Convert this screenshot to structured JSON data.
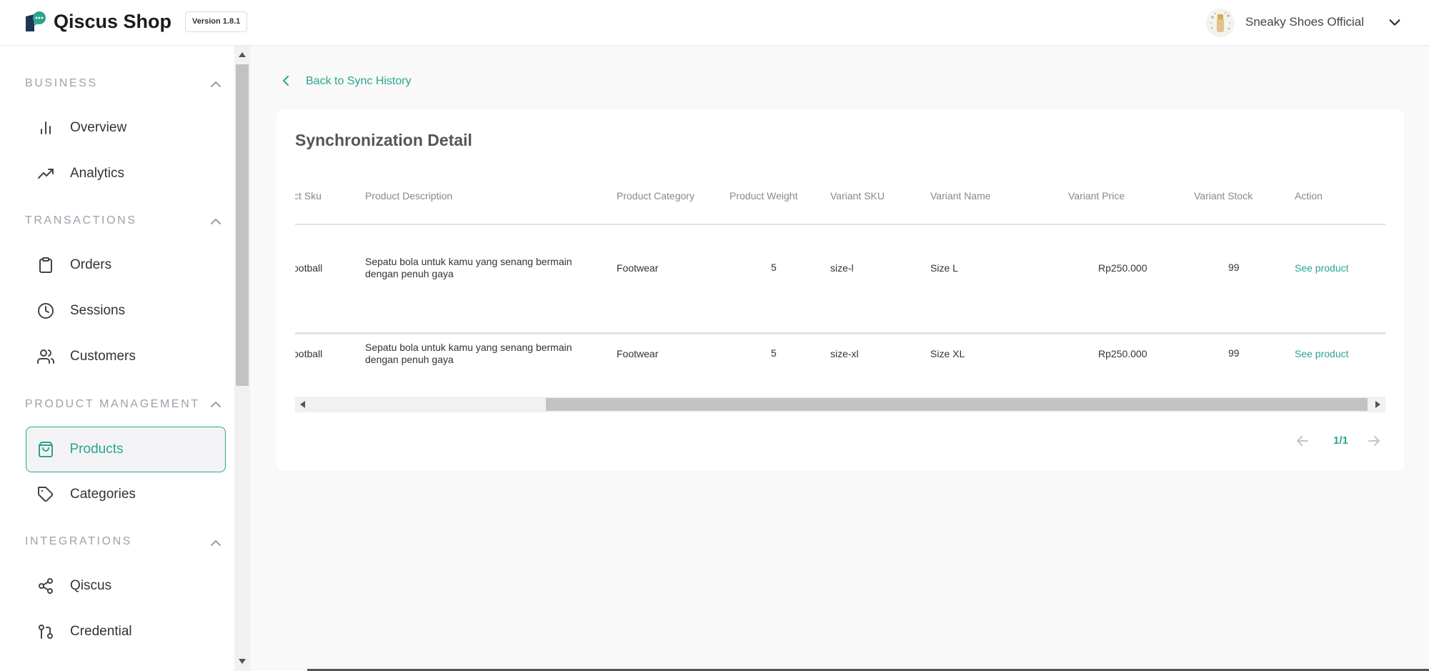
{
  "app": {
    "title": "Qiscus Shop",
    "version": "Version 1.8.1",
    "store_name": "Sneaky Shoes Official",
    "accent_color": "#2aa58f"
  },
  "sidebar": {
    "sections": [
      {
        "label": "BUSINESS",
        "items": [
          {
            "label": "Overview",
            "icon": "bar-chart-icon"
          },
          {
            "label": "Analytics",
            "icon": "trending-up-icon"
          }
        ]
      },
      {
        "label": "TRANSACTIONS",
        "items": [
          {
            "label": "Orders",
            "icon": "clipboard-icon"
          },
          {
            "label": "Sessions",
            "icon": "clock-icon"
          },
          {
            "label": "Customers",
            "icon": "users-icon"
          }
        ]
      },
      {
        "label": "PRODUCT MANAGEMENT",
        "items": [
          {
            "label": "Products",
            "icon": "shopping-bag-icon",
            "active": true
          },
          {
            "label": "Categories",
            "icon": "tag-icon"
          }
        ]
      },
      {
        "label": "INTEGRATIONS",
        "items": [
          {
            "label": "Qiscus",
            "icon": "share-icon"
          },
          {
            "label": "Credential",
            "icon": "git-pull-request-icon"
          }
        ]
      }
    ]
  },
  "main": {
    "back_label": "Back to Sync History",
    "card_title": "Synchronization Detail",
    "columns": [
      "ct Sku",
      "Product Description",
      "Product Category",
      "Product Weight",
      "Variant SKU",
      "Variant Name",
      "Variant Price",
      "Variant Stock",
      "Action"
    ],
    "rows": [
      {
        "sku": "ootball",
        "description": "Sepatu bola untuk kamu yang senang bermain dengan penuh gaya",
        "category": "Footwear",
        "weight": "5",
        "variant_sku": "size-l",
        "variant_name": "Size L",
        "price": "Rp250.000",
        "stock": "99",
        "action": "See product"
      },
      {
        "sku": "ootball",
        "description": "Sepatu bola untuk kamu yang senang bermain dengan penuh gaya",
        "category": "Footwear",
        "weight": "5",
        "variant_sku": "size-xl",
        "variant_name": "Size XL",
        "price": "Rp250.000",
        "stock": "99",
        "action": "See product"
      }
    ],
    "pagination": "1/1"
  }
}
